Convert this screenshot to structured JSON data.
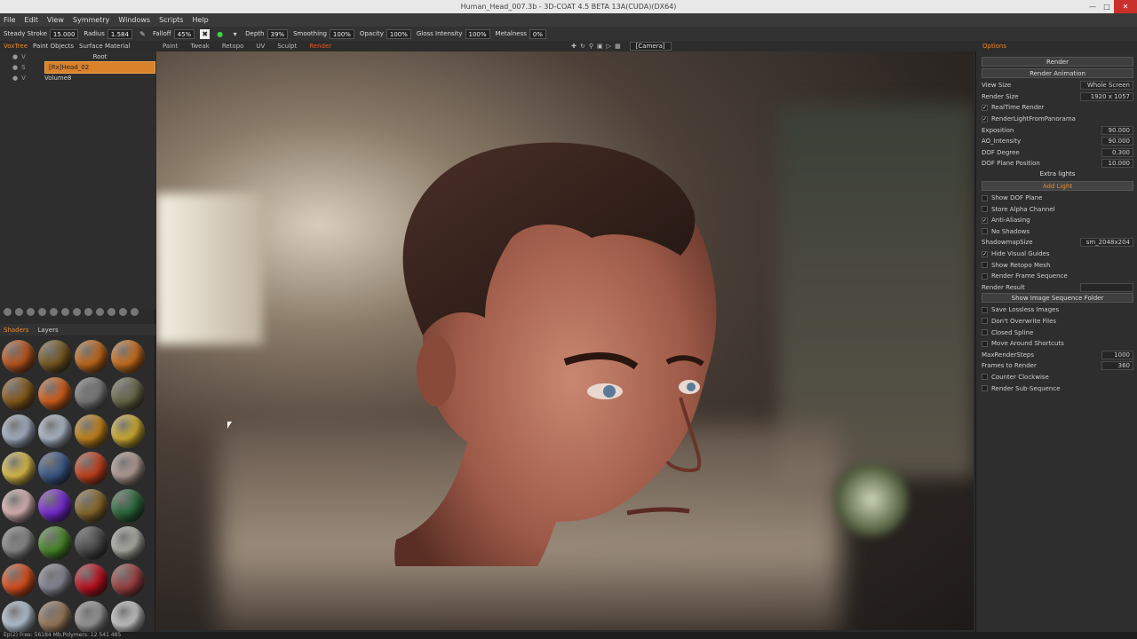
{
  "window": {
    "title": "Human_Head_007.3b - 3D-COAT 4.5 BETA 13A(CUDA)(DX64)"
  },
  "menu": [
    "File",
    "Edit",
    "View",
    "Symmetry",
    "Windows",
    "Scripts",
    "Help"
  ],
  "toolbar": {
    "steady_stroke": {
      "label": "Steady Stroke",
      "value": "15.000"
    },
    "radius": {
      "label": "Radius",
      "value": "1.584"
    },
    "falloff": {
      "label": "Falloff",
      "value": "45%"
    },
    "depth": {
      "label": "Depth",
      "value": "39%"
    },
    "smoothing": {
      "label": "Smoothing",
      "value": "100%"
    },
    "opacity": {
      "label": "Opacity",
      "value": "100%"
    },
    "gloss": {
      "label": "Gloss Intensity",
      "value": "100%"
    },
    "metalness": {
      "label": "Metalness",
      "value": "0%"
    }
  },
  "left_tabs": [
    "VoxTree",
    "Paint Objects",
    "Surface Material"
  ],
  "rooms": [
    "Paint",
    "Tweak",
    "Retopo",
    "UV",
    "Sculpt",
    "Render"
  ],
  "camera": "[Camera]",
  "right_tab": "Options",
  "tree": [
    {
      "ctrls": "V",
      "name": "Root",
      "sel": false
    },
    {
      "ctrls": "S",
      "name": "[Rx]Head_02",
      "sel": true
    },
    {
      "ctrls": "V",
      "name": "Volume8",
      "sel": false
    }
  ],
  "subtabs": [
    "Shaders",
    "Layers"
  ],
  "shaders": [
    "#c0561c",
    "#7a5a20",
    "#c66a1a",
    "#d0701c",
    "#8a5a1a",
    "#d8601a",
    "#7a7a7a",
    "#6a6a4a",
    "#a8b4c8",
    "#b0bccc",
    "#c8861a",
    "#d4b030",
    "#e0c04a",
    "#3a5a8a",
    "#c8401c",
    "#b8a098",
    "#e0b8b8",
    "#7a2ad8",
    "#8a6a2a",
    "#2a6a3a",
    "#8a8a8a",
    "#4a8a2a",
    "#4a4a4a",
    "#b0b0a8",
    "#e0501c",
    "#8a8a9a",
    "#c01020",
    "#a04040",
    "#b8c8d8",
    "#9a7a5a",
    "#9a9a9a",
    "#c8c8c8"
  ],
  "render": {
    "header": "Render",
    "animation_button": "Render Animation",
    "view_size": {
      "label": "View Size",
      "value": "Whole Screen"
    },
    "render_size": {
      "label": "Render Size",
      "value": "1920 x 1057"
    },
    "checks_top": [
      {
        "label": "RealTime Render",
        "checked": true
      },
      {
        "label": "RenderLightFromPanorama",
        "checked": true
      }
    ],
    "exposition": {
      "label": "Exposition",
      "value": "90.000"
    },
    "ao_intensity": {
      "label": "AO_Intensity",
      "value": "90.000"
    },
    "dof_degree": {
      "label": "DOF Degree",
      "value": "0.300"
    },
    "dof_plane": {
      "label": "DOF Plane Position",
      "value": "10.000"
    },
    "extra_lights": "Extra lights",
    "add_light": "Add Light",
    "checks_mid": [
      {
        "label": "Show DOF Plane",
        "checked": false
      },
      {
        "label": "Store Alpha Channel",
        "checked": false
      },
      {
        "label": "Anti-Aliasing",
        "checked": true
      },
      {
        "label": "No Shadows",
        "checked": false
      }
    ],
    "shadowmap": {
      "label": "ShadowmapSize",
      "value": "sm_2048x204"
    },
    "checks_low": [
      {
        "label": "Hide Visual Guides",
        "checked": true
      },
      {
        "label": "Show Retopo Mesh",
        "checked": false
      },
      {
        "label": "Render Frame Sequence",
        "checked": false
      }
    ],
    "render_result": "Render Result",
    "show_folder": "Show Image Sequence Folder",
    "checks_seq": [
      {
        "label": "Save Lossless Images",
        "checked": false
      },
      {
        "label": "Don't Overwrite Files",
        "checked": false
      },
      {
        "label": "Closed Spline",
        "checked": false
      },
      {
        "label": "Move Around Shortcuts",
        "checked": false
      }
    ],
    "max_steps": {
      "label": "MaxRenderSteps",
      "value": "1000"
    },
    "frames": {
      "label": "Frames to Render",
      "value": "360"
    },
    "checks_end": [
      {
        "label": "Counter Clockwise",
        "checked": false
      },
      {
        "label": "Render Sub-Sequence",
        "checked": false
      }
    ]
  },
  "status": "Ep(2)     Free: 56184 Mb,Polymers: 12 541 485"
}
